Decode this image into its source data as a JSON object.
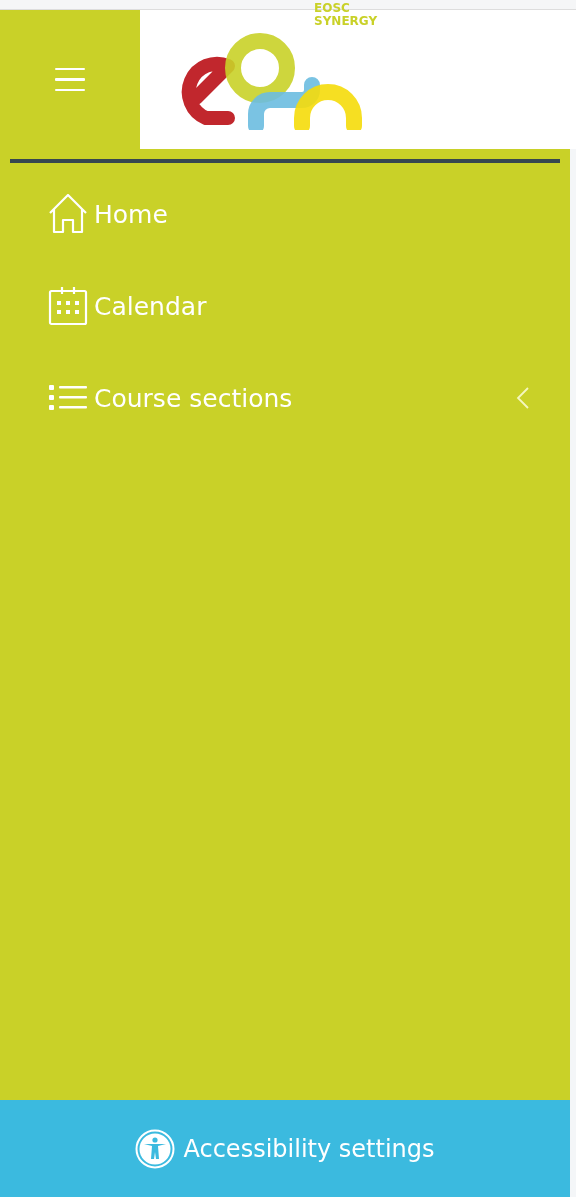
{
  "header": {
    "logo_text": [
      "EOSC",
      "SYNERGY"
    ]
  },
  "nav": [
    {
      "label": "Home"
    },
    {
      "label": "Calendar"
    },
    {
      "label": "Course sections",
      "expanded": false
    }
  ],
  "footer": {
    "label": "Accessibility settings"
  }
}
